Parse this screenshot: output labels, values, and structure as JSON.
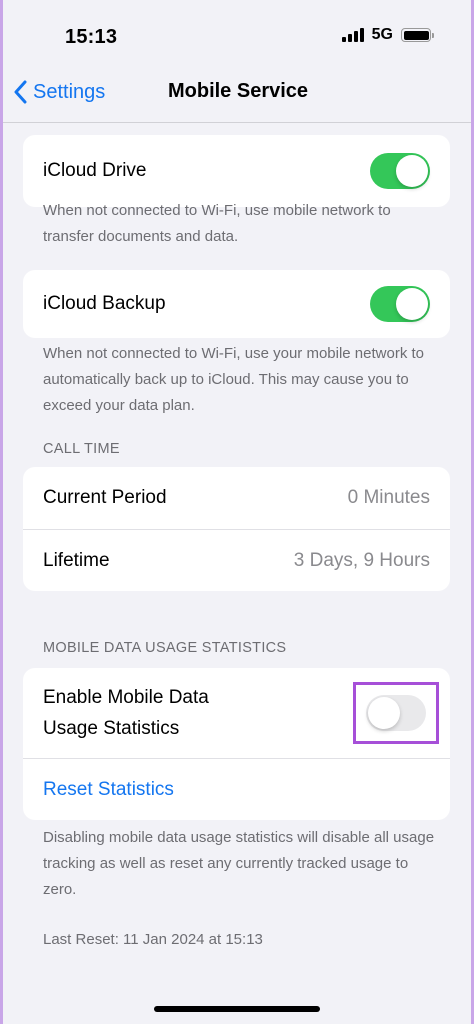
{
  "status_bar": {
    "time": "15:13",
    "network": "5G"
  },
  "nav": {
    "back_label": "Settings",
    "title": "Mobile Service"
  },
  "icloud_drive": {
    "label": "iCloud Drive",
    "enabled": true,
    "footnote": "When not connected to Wi-Fi, use mobile network to transfer documents and data."
  },
  "icloud_backup": {
    "label": "iCloud Backup",
    "enabled": true,
    "footnote": "When not connected to Wi-Fi, use your mobile network to automatically back up to iCloud. This may cause you to exceed your data plan."
  },
  "call_time": {
    "header": "CALL TIME",
    "rows": [
      {
        "label": "Current Period",
        "value": "0 Minutes"
      },
      {
        "label": "Lifetime",
        "value": "3 Days, 9 Hours"
      }
    ]
  },
  "usage_stats": {
    "header": "MOBILE DATA USAGE STATISTICS",
    "toggle_label": "Enable Mobile Data Usage Statistics",
    "enabled": false,
    "reset_label": "Reset Statistics",
    "footnote": "Disabling mobile data usage statistics will disable all usage tracking as well as reset any currently tracked usage to zero.",
    "last_reset": "Last Reset: 11 Jan 2024 at 15:13"
  },
  "colors": {
    "accent": "#1476f0",
    "toggle_on": "#34c759",
    "highlight": "#a64fd8"
  }
}
